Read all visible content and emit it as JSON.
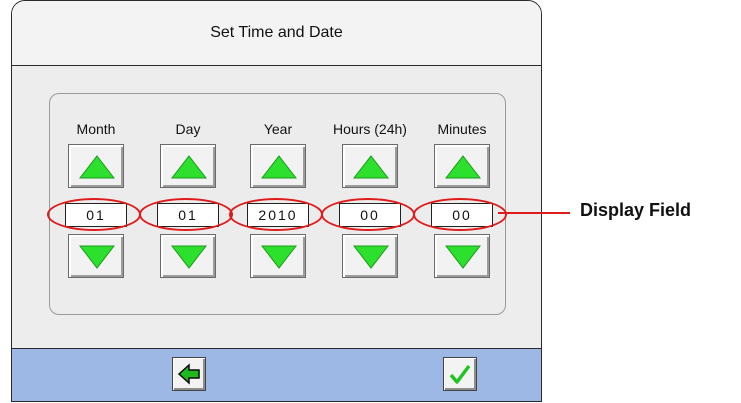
{
  "window": {
    "title": "Set Time and Date"
  },
  "fields": [
    {
      "label": "Month",
      "value": "01"
    },
    {
      "label": "Day",
      "value": "01"
    },
    {
      "label": "Year",
      "value": "2010"
    },
    {
      "label": "Hours (24h)",
      "value": "00"
    },
    {
      "label": "Minutes",
      "value": "00"
    }
  ],
  "buttons": {
    "increment_icon": "up-triangle-icon",
    "decrement_icon": "down-triangle-icon",
    "back_icon": "back-arrow-icon",
    "confirm_icon": "checkmark-icon"
  },
  "callout": {
    "label": "Display Field"
  },
  "colors": {
    "arrow_green": "#2ee02e",
    "highlight_red": "#e01b1b",
    "bottom_bar": "#9eb8e6"
  }
}
